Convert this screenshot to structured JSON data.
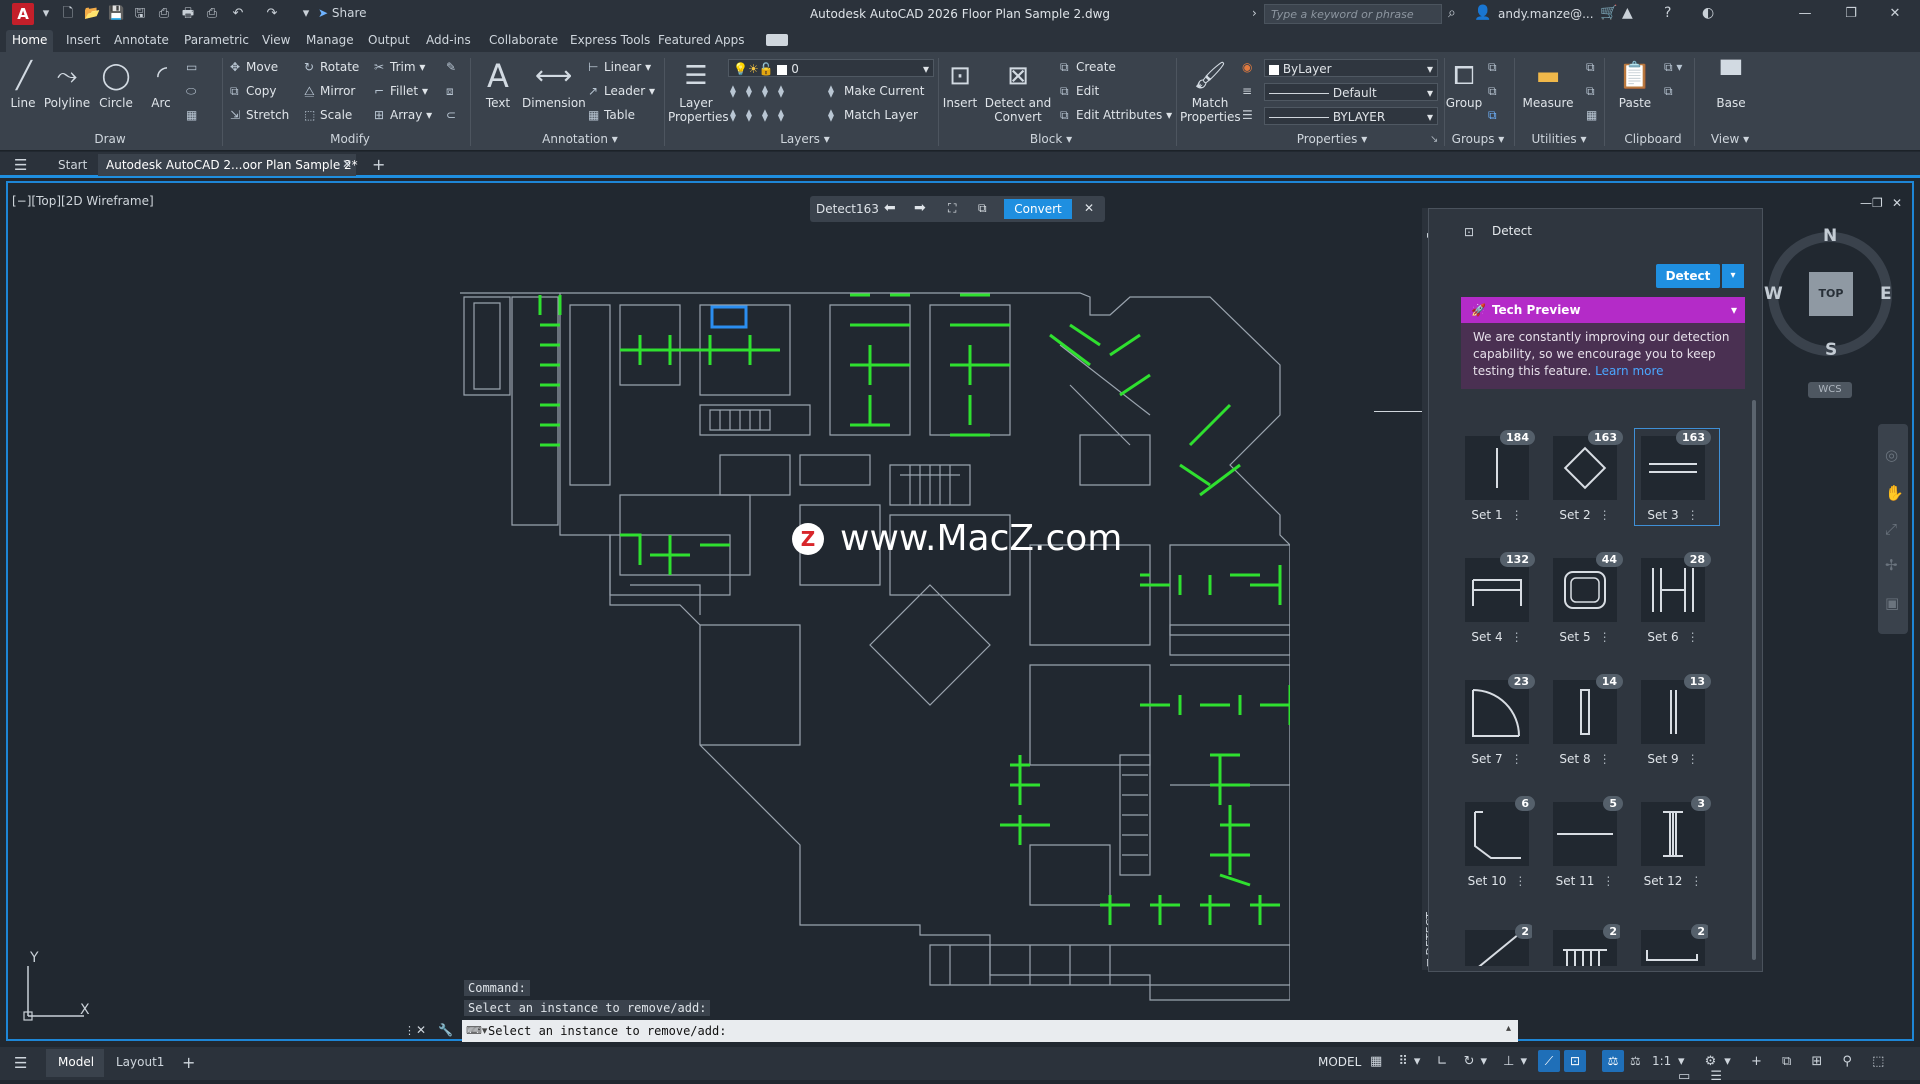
{
  "window": {
    "app_logo": "A",
    "title": "Autodesk AutoCAD 2026   Floor Plan Sample 2.dwg",
    "share_label": "Share",
    "search_placeholder": "Type a keyword or phrase",
    "user": "andy.manze@..."
  },
  "ribbon_tabs": [
    "Home",
    "Insert",
    "Annotate",
    "Parametric",
    "View",
    "Manage",
    "Output",
    "Add-ins",
    "Collaborate",
    "Express Tools",
    "Featured Apps"
  ],
  "ribbon": {
    "draw": {
      "label": "Draw",
      "line": "Line",
      "polyline": "Polyline",
      "circle": "Circle",
      "arc": "Arc"
    },
    "modify": {
      "label": "Modify",
      "move": "Move",
      "rotate": "Rotate",
      "trim": "Trim",
      "copy": "Copy",
      "mirror": "Mirror",
      "fillet": "Fillet",
      "stretch": "Stretch",
      "scale": "Scale",
      "array": "Array"
    },
    "annotation": {
      "label": "Annotation",
      "text": "Text",
      "dimension": "Dimension",
      "linear": "Linear",
      "leader": "Leader",
      "table": "Table"
    },
    "layers": {
      "label": "Layers",
      "layer_properties": "Layer Properties",
      "layer_value": "0",
      "make_current": "Make Current",
      "match_layer": "Match Layer"
    },
    "block": {
      "label": "Block",
      "insert": "Insert",
      "detect_convert": "Detect and Convert",
      "create": "Create",
      "edit": "Edit",
      "edit_attributes": "Edit Attributes"
    },
    "properties": {
      "label": "Properties",
      "match_properties": "Match Properties",
      "color": "ByLayer",
      "linetype": "Default",
      "lineweight": "BYLAYER"
    },
    "groups": {
      "label": "Groups",
      "group": "Group"
    },
    "utilities": {
      "label": "Utilities",
      "measure": "Measure"
    },
    "clipboard": {
      "label": "Clipboard",
      "paste": "Paste"
    },
    "view": {
      "label": "View",
      "base": "Base"
    }
  },
  "file_tabs": {
    "start": "Start",
    "active": "Autodesk AutoCAD 2...oor Plan Sample 2*"
  },
  "viewport": {
    "label": "[−][Top][2D Wireframe]",
    "detect_label": "Detect",
    "detect_count": "163",
    "convert_label": "Convert"
  },
  "watermark": "www.MacZ.com",
  "palette": {
    "title": "Detect",
    "detect_button": "Detect",
    "tech_preview": "Tech Preview",
    "tech_text": "We are constantly improving our detection capability, so we encourage you to keep testing this feature.",
    "learn_more": "Learn more",
    "side_label": "DETECT",
    "sets": [
      {
        "name": "Set 1",
        "count": "184"
      },
      {
        "name": "Set 2",
        "count": "163"
      },
      {
        "name": "Set 3",
        "count": "163"
      },
      {
        "name": "Set 4",
        "count": "132"
      },
      {
        "name": "Set 5",
        "count": "44"
      },
      {
        "name": "Set 6",
        "count": "28"
      },
      {
        "name": "Set 7",
        "count": "23"
      },
      {
        "name": "Set 8",
        "count": "14"
      },
      {
        "name": "Set 9",
        "count": "13"
      },
      {
        "name": "Set 10",
        "count": "6"
      },
      {
        "name": "Set 11",
        "count": "5"
      },
      {
        "name": "Set 12",
        "count": "3"
      },
      {
        "name": "",
        "count": "2"
      },
      {
        "name": "",
        "count": "2"
      },
      {
        "name": "",
        "count": "2"
      }
    ]
  },
  "viewcube": {
    "n": "N",
    "s": "S",
    "e": "E",
    "w": "W",
    "top": "TOP",
    "wcs": "WCS"
  },
  "command": {
    "history_1": "Command:",
    "history_2": "Select an instance to remove/add:",
    "prompt": "Select an instance to remove/add:"
  },
  "status": {
    "model_tab": "Model",
    "layout_tab": "Layout1",
    "model_label": "MODEL",
    "scale": "1:1"
  },
  "colors": {
    "accent": "#1f8fe0",
    "tech_preview": "#b42bc8",
    "detected": "#2fe02f",
    "drawing": "#9aa4ae"
  }
}
